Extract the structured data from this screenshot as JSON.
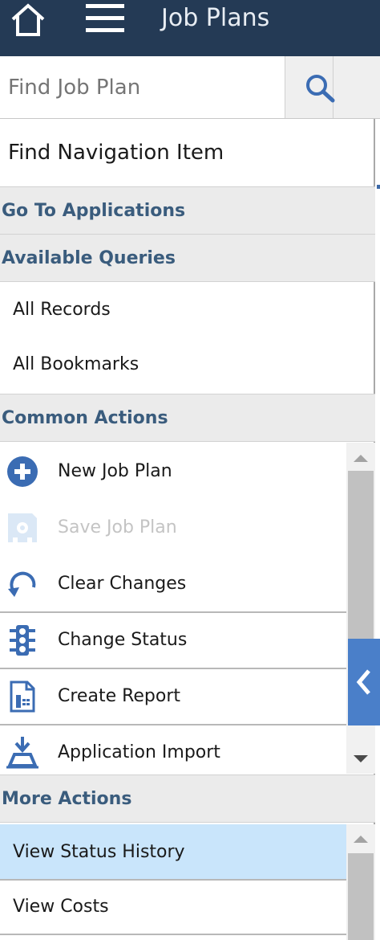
{
  "header": {
    "title": "Job Plans",
    "home_icon": "home-icon",
    "menu_icon": "hamburger-menu-icon",
    "background": "#243a55"
  },
  "search": {
    "value": "",
    "placeholder": "Find Job Plan",
    "icon": "search-icon"
  },
  "navigation": {
    "find_item_placeholder": "Find Navigation Item"
  },
  "sections": {
    "go_to_applications": "Go To Applications",
    "available_queries": "Available Queries",
    "common_actions": "Common Actions",
    "more_actions": "More Actions"
  },
  "queries": [
    {
      "label": "All Records"
    },
    {
      "label": "All Bookmarks"
    }
  ],
  "common_actions": [
    {
      "label": "New Job Plan",
      "icon": "add-circle-icon",
      "enabled": true
    },
    {
      "label": "Save Job Plan",
      "icon": "save-icon",
      "enabled": false
    },
    {
      "label": "Clear Changes",
      "icon": "undo-icon",
      "enabled": true
    },
    {
      "label": "Change Status",
      "icon": "traffic-light-icon",
      "enabled": true
    },
    {
      "label": "Create Report",
      "icon": "report-icon",
      "enabled": true
    },
    {
      "label": "Application Import",
      "icon": "import-icon",
      "enabled": true
    }
  ],
  "more_actions": [
    {
      "label": "View Status History",
      "selected": true
    },
    {
      "label": "View Costs",
      "selected": false
    }
  ],
  "colors": {
    "accent": "#3b6cb3",
    "section_text": "#3a5c7d",
    "selected_row": "#c9e5fb",
    "collapse_tab": "#4a7fc9"
  }
}
